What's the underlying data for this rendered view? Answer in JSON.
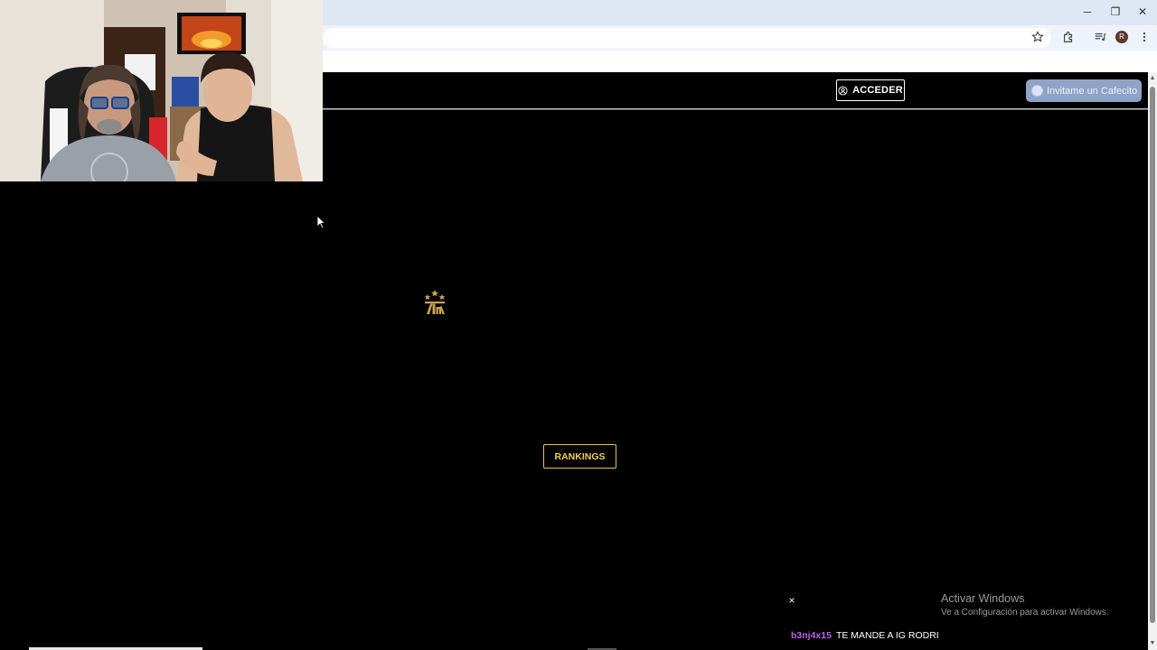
{
  "window_controls": {
    "minimize": "─",
    "restore": "❐",
    "close": "✕"
  },
  "toolbar": {
    "bookmark_icon": "star-icon",
    "extensions_icon": "puzzle-icon",
    "media_icon": "media-queue-icon",
    "profile_initial": "R",
    "menu_icon": "kebab-menu-icon"
  },
  "header": {
    "login_label": "ACCEDER",
    "donate_label": "Invitame un Cafecito"
  },
  "content": {
    "rankings_label": "RANKINGS"
  },
  "chat": {
    "close_glyph": "×",
    "username": "b3nj4x15",
    "message": "TE MANDE A IG RODRI"
  },
  "windows_watermark": {
    "title": "Activar Windows",
    "subtitle": "Ve a Configuración para activar Windows."
  },
  "colors": {
    "accent_gold": "#e8c44a",
    "chat_username": "#c15ee8",
    "cafecito_bg": "#8fa3c7"
  }
}
